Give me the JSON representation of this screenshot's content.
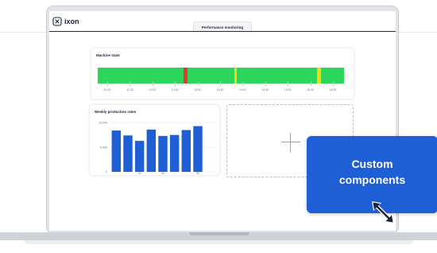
{
  "app": {
    "brand": "ixon",
    "tab": "Performance monitoring"
  },
  "machine_state": {
    "title": "Machine state",
    "time_labels": [
      "11:00",
      "11:30",
      "12:00",
      "12:30",
      "13:00",
      "13:30",
      "14:00",
      "14:30",
      "15:00",
      "15:30",
      "16:00"
    ],
    "segments": [
      {
        "state": "running",
        "start": 0.0,
        "end": 0.347,
        "color": "#2dd65a"
      },
      {
        "state": "stopped",
        "start": 0.347,
        "end": 0.366,
        "color": "#e8372c"
      },
      {
        "state": "running",
        "start": 0.366,
        "end": 0.556,
        "color": "#2dd65a"
      },
      {
        "state": "warning",
        "start": 0.556,
        "end": 0.565,
        "color": "#f2d90f"
      },
      {
        "state": "running",
        "start": 0.565,
        "end": 0.89,
        "color": "#2dd65a"
      },
      {
        "state": "warning",
        "start": 0.89,
        "end": 0.906,
        "color": "#f2d90f"
      },
      {
        "state": "running",
        "start": 0.906,
        "end": 1.0,
        "color": "#2dd65a"
      }
    ],
    "colors": {
      "running": "#2dd65a",
      "stopped": "#e8372c",
      "warning": "#f2d90f"
    }
  },
  "chart_data": {
    "type": "bar",
    "title": "Weekly production rates",
    "categories": [
      "",
      "",
      "30",
      "",
      "40",
      "",
      "",
      "50",
      ""
    ],
    "values": [
      8400,
      7400,
      6300,
      8600,
      7300,
      7500,
      8500,
      9300,
      0
    ],
    "y_ticks": [
      "0",
      "5.000",
      "10.000"
    ],
    "ylim": [
      0,
      11000
    ],
    "bar_color": "#1e5fd6"
  },
  "callout": {
    "line1": "Custom",
    "line2": "components"
  },
  "colors": {
    "navy": "#1b2440",
    "accent": "#1e5fd6"
  },
  "icons": {
    "logo": "ixon-logo-icon",
    "add": "plus-icon",
    "resize": "diagonal-resize-arrow-icon"
  }
}
